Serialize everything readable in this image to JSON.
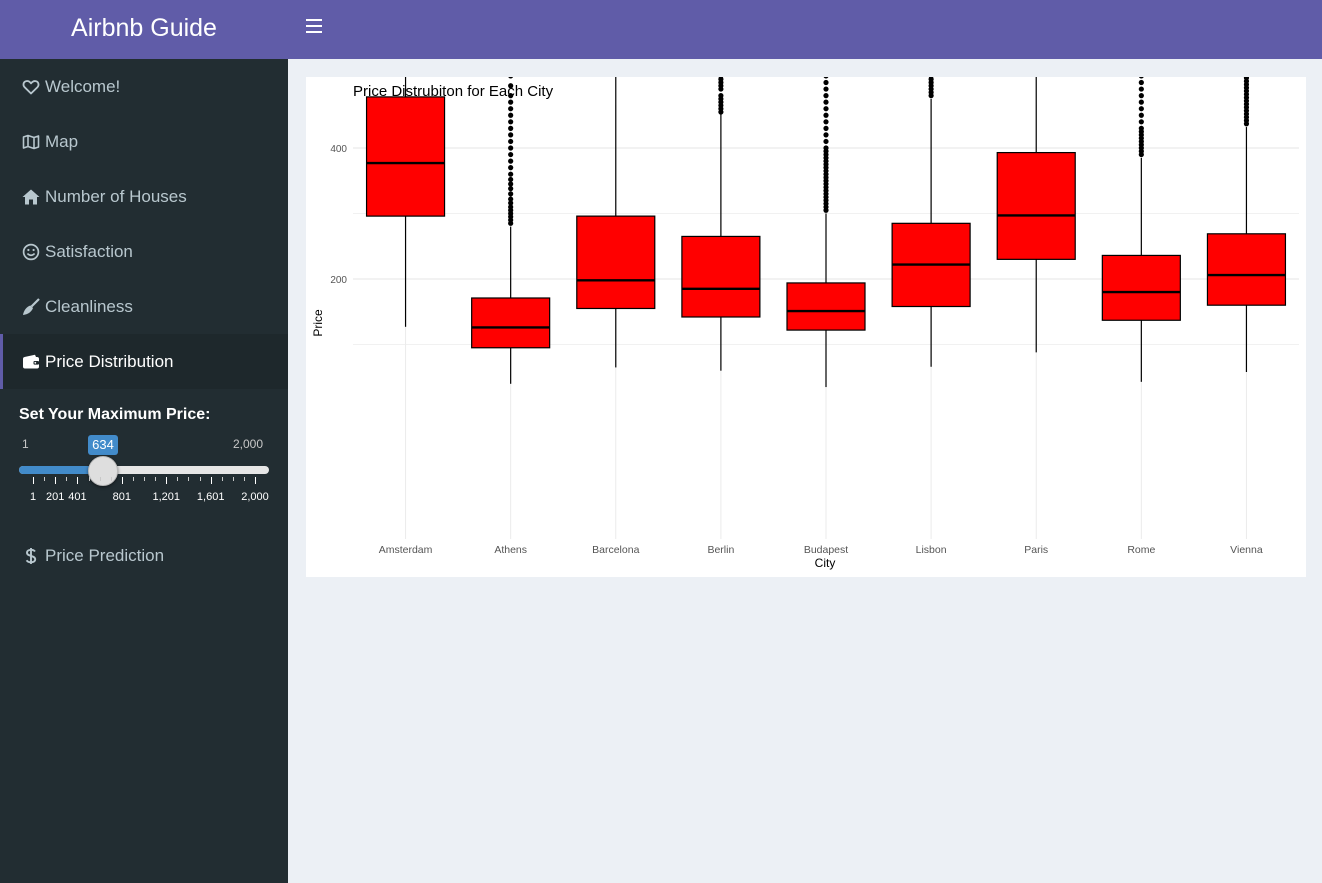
{
  "header": {
    "app_title": "Airbnb Guide",
    "menu_icon": "hamburger-menu-icon",
    "colors": {
      "brand": "#605ca8",
      "sidebar": "#222d32",
      "sidebar_active": "#1e282c",
      "accent": "#428bca"
    }
  },
  "sidebar": {
    "items": [
      {
        "label": "Welcome!",
        "icon": "heart-icon"
      },
      {
        "label": "Map",
        "icon": "map-icon"
      },
      {
        "label": "Number of Houses",
        "icon": "home-icon"
      },
      {
        "label": "Satisfaction",
        "icon": "smile-icon"
      },
      {
        "label": "Cleanliness",
        "icon": "broom-icon"
      },
      {
        "label": "Price Distribution",
        "icon": "wallet-icon",
        "active": true
      },
      {
        "label": "Price Prediction",
        "icon": "dollar-icon"
      }
    ]
  },
  "slider": {
    "label": "Set Your Maximum Price:",
    "min": 1,
    "max": 2000,
    "value": 634,
    "min_label": "1",
    "max_label": "2,000",
    "value_label": "634",
    "ticks": [
      {
        "value": 1,
        "label": "1"
      },
      {
        "value": 201,
        "label": "201"
      },
      {
        "value": 401,
        "label": "401"
      },
      {
        "value": 801,
        "label": "801"
      },
      {
        "value": 1201,
        "label": "1,201"
      },
      {
        "value": 1601,
        "label": "1,601"
      },
      {
        "value": 2000,
        "label": "2,000"
      }
    ]
  },
  "chart_data": {
    "type": "boxplot",
    "title": "Price Distrubiton for Each City",
    "xlabel": "City",
    "ylabel": "Price",
    "ylim": [
      0,
      634
    ],
    "yticks": [
      200,
      400,
      600
    ],
    "grid": true,
    "box_color": "#ff0000",
    "categories": [
      "Amsterdam",
      "Athens",
      "Barcelona",
      "Berlin",
      "Budapest",
      "Lisbon",
      "Paris",
      "Rome",
      "Vienna"
    ],
    "boxes": [
      {
        "city": "Amsterdam",
        "whisker_low": 127,
        "q1": 296,
        "median": 377,
        "q3": 478,
        "whisker_high": 633,
        "outliers": []
      },
      {
        "city": "Athens",
        "whisker_low": 40,
        "q1": 95,
        "median": 126,
        "q3": 171,
        "whisker_high": 280,
        "outliers": [
          285,
          290,
          295,
          300,
          305,
          310,
          316,
          322,
          330,
          338,
          345,
          352,
          360,
          370,
          380,
          390,
          400,
          410,
          420,
          430,
          440,
          450,
          460,
          470,
          480,
          495,
          510,
          520,
          535,
          560,
          572,
          590,
          600,
          612,
          622
        ]
      },
      {
        "city": "Barcelona",
        "whisker_low": 65,
        "q1": 155,
        "median": 198,
        "q3": 296,
        "whisker_high": 510,
        "outliers": [
          515,
          520,
          525,
          530,
          535,
          540,
          545,
          550,
          555,
          560,
          565,
          570,
          575,
          580,
          585,
          590,
          595,
          600,
          605,
          610,
          615,
          620,
          625,
          630
        ]
      },
      {
        "city": "Berlin",
        "whisker_low": 60,
        "q1": 142,
        "median": 185,
        "q3": 265,
        "whisker_high": 452,
        "outliers": [
          455,
          460,
          465,
          470,
          475,
          480,
          490,
          495,
          500,
          505,
          510,
          515,
          525,
          535,
          545,
          555,
          560,
          570,
          580,
          590,
          600,
          610,
          615,
          620,
          625
        ]
      },
      {
        "city": "Budapest",
        "whisker_low": 35,
        "q1": 122,
        "median": 151,
        "q3": 194,
        "whisker_high": 300,
        "outliers": [
          305,
          310,
          315,
          320,
          325,
          330,
          335,
          340,
          345,
          350,
          355,
          360,
          365,
          370,
          375,
          380,
          385,
          390,
          395,
          400,
          410,
          420,
          430,
          440,
          450,
          460,
          470,
          480,
          490,
          500,
          510,
          525,
          540,
          560,
          575,
          590,
          602,
          620
        ]
      },
      {
        "city": "Lisbon",
        "whisker_low": 66,
        "q1": 158,
        "median": 222,
        "q3": 285,
        "whisker_high": 475,
        "outliers": [
          480,
          485,
          490,
          495,
          500,
          505,
          510,
          515,
          520,
          525,
          530,
          535,
          540,
          545,
          550,
          560,
          570,
          580,
          590,
          600,
          610,
          615,
          620,
          625,
          630
        ]
      },
      {
        "city": "Paris",
        "whisker_low": 88,
        "q1": 230,
        "median": 297,
        "q3": 393,
        "whisker_high": 633,
        "outliers": []
      },
      {
        "city": "Rome",
        "whisker_low": 43,
        "q1": 137,
        "median": 180,
        "q3": 236,
        "whisker_high": 385,
        "outliers": [
          390,
          395,
          400,
          405,
          410,
          415,
          420,
          425,
          430,
          440,
          450,
          460,
          470,
          480,
          490,
          500,
          510,
          520,
          530,
          540,
          550,
          560,
          570,
          580,
          590,
          600,
          615,
          625,
          632
        ]
      },
      {
        "city": "Vienna",
        "whisker_low": 58,
        "q1": 160,
        "median": 206,
        "q3": 269,
        "whisker_high": 432,
        "outliers": [
          437,
          442,
          447,
          452,
          457,
          462,
          467,
          472,
          477,
          482,
          487,
          492,
          497,
          502,
          507,
          512,
          517,
          522,
          527,
          532,
          537,
          542,
          550,
          560,
          570,
          580,
          590,
          600,
          610,
          615,
          620,
          625
        ]
      }
    ]
  }
}
